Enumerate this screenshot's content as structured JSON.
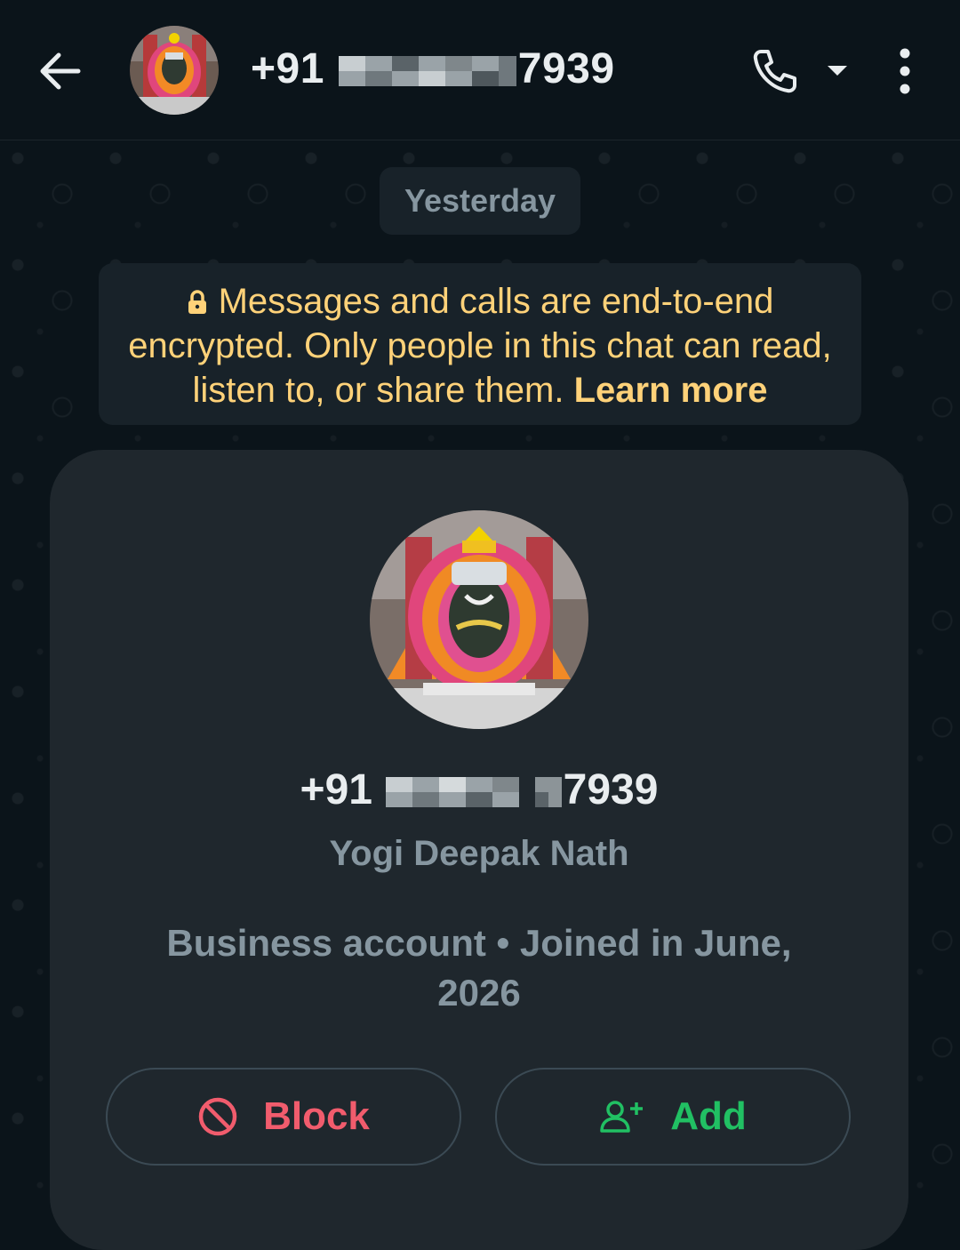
{
  "header": {
    "title_prefix": "+91",
    "title_suffix": "7939",
    "back_icon": "arrow-left-icon",
    "call_icon": "phone-icon",
    "dropdown_icon": "caret-down-icon",
    "menu_icon": "more-vert-icon"
  },
  "chat": {
    "date_chip": "Yesterday",
    "encryption_notice": "Messages and calls are end-to-end encrypted. Only people in this chat can read, listen to, or share them.",
    "encryption_link": "Learn more"
  },
  "contact_card": {
    "phone_prefix": "+91",
    "phone_suffix": "7939",
    "name": "Yogi Deepak Nath",
    "info": "Business account • Joined in June, 2026",
    "block_label": "Block",
    "add_label": "Add"
  },
  "colors": {
    "background": "#0b141a",
    "card": "#1f272d",
    "notice_text": "#ffd279",
    "block": "#f15c6d",
    "add": "#21c063"
  }
}
